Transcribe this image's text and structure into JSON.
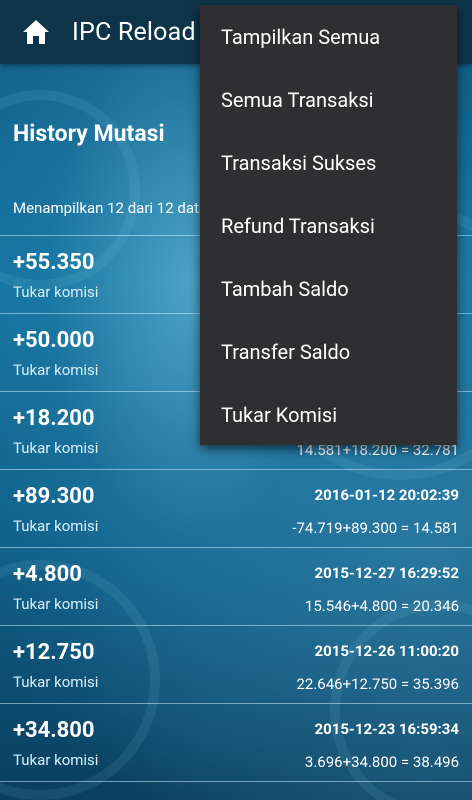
{
  "appbar": {
    "title": "IPC Reload",
    "home_icon": "home-icon"
  },
  "section_title": "History Mutasi",
  "summary": "Menampilkan 12 dari 12 data",
  "menu": {
    "items": [
      "Tampilkan Semua",
      "Semua Transaksi",
      "Transaksi Sukses",
      "Refund Transaksi",
      "Tambah Saldo",
      "Transfer Saldo",
      "Tukar Komisi"
    ]
  },
  "transactions": [
    {
      "amount": "+55.350",
      "type": "Tukar komisi",
      "datetime": "",
      "calc": ""
    },
    {
      "amount": "+50.000",
      "type": "Tukar komisi",
      "datetime": "",
      "calc": ""
    },
    {
      "amount": "+18.200",
      "type": "Tukar komisi",
      "datetime": "",
      "calc": "14.581+18.200 = 32.781"
    },
    {
      "amount": "+89.300",
      "type": "Tukar komisi",
      "datetime": "2016-01-12 20:02:39",
      "calc": "-74.719+89.300 = 14.581"
    },
    {
      "amount": "+4.800",
      "type": "Tukar komisi",
      "datetime": "2015-12-27 16:29:52",
      "calc": "15.546+4.800 = 20.346"
    },
    {
      "amount": "+12.750",
      "type": "Tukar komisi",
      "datetime": "2015-12-26 11:00:20",
      "calc": "22.646+12.750 = 35.396"
    },
    {
      "amount": "+34.800",
      "type": "Tukar komisi",
      "datetime": "2015-12-23 16:59:34",
      "calc": "3.696+34.800 = 38.496"
    }
  ],
  "colors": {
    "appbar": "#0e3449",
    "menu_bg": "#2f2f31",
    "background": "#13729e"
  }
}
